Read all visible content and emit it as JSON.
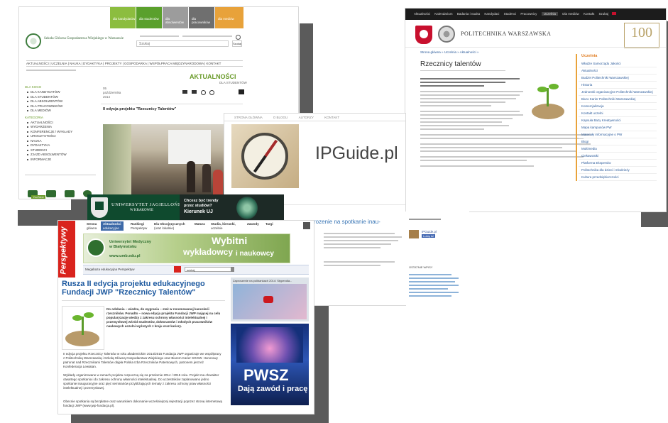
{
  "sggw": {
    "logo_text": "Szkoła Główna Gospodarstwa Wiejskiego w Warszawie",
    "tiles": [
      {
        "label": "dla kandydatów",
        "color": "#8cbd3f"
      },
      {
        "label": "dla studentów",
        "color": "#5aa02c"
      },
      {
        "label": "dla absolwentów",
        "color": "#9c9c9c"
      },
      {
        "label": "dla pracowników",
        "color": "#6f6f6f"
      },
      {
        "label": "dla mediów",
        "color": "#e8a23a"
      }
    ],
    "search_placeholder": "Szukaj",
    "search_button": "Szukaj",
    "nav": "AKTUALNOŚCI | UCZELNIA | NAUKA | DYDAKTYKA | PROJEKTY | GOSPODARKA | WSPÓŁPRACA MIĘDZYNARODOWA | KONTAKT",
    "heading": "AKTUALNOŚCI",
    "subheading": "DLA STUDENTÓW",
    "sidebar_title_1": "DLA KOGO",
    "sidebar_1": [
      "DLA KANDYDATÓW",
      "DLA STUDENTÓW",
      "DLA ABSOLWENTÓW",
      "DLA PRACOWNIKÓW",
      "DLA MEDIÓW"
    ],
    "sidebar_title_2": "KATEGORIA",
    "sidebar_2": [
      "AKTUALNOŚCI",
      "WYDARZENIA",
      "KONFERENCJE / WYKŁADY",
      "UROCZYSTOŚCI",
      "NAUKA",
      "DYDAKTYKA",
      "STUDENCI",
      "ZJAZD ABSOLWENTÓW",
      "INFORMACJE"
    ],
    "date_day": "05",
    "date_month": "października",
    "date_year": "2014",
    "article_title": "II edycja projektu \"Rzecznicy Talentów\"",
    "youtube": "YouTube"
  },
  "pw": {
    "topnav": [
      "Aktualności",
      "Kalendarium",
      "Badania i nauka",
      "Kandydaci",
      "Studenci",
      "Pracownicy",
      "Uczelnia",
      "Dla mediów",
      "Kontakt",
      "Szukaj"
    ],
    "name": "POLITECHNIKA WARSZAWSKA",
    "breadcrumb": "Strona główna » Uczelnia » Aktualności »",
    "title": "Rzecznicy talentów",
    "sidebar_title": "Uczelnia",
    "sidebar": [
      "Władze Samorządu Jakości",
      "Aktualności",
      "Budżet Politechniki Warszawskiej",
      "Historia",
      "Jednostki organizacyjne Politechniki Warszawskiej",
      "Biuro Karier Politechniki Warszawskiej",
      "Komercjalizacja",
      "Kontakt uczelni",
      "Kapsuła Bazy Kreatywności",
      "Mapa kampusów PW",
      "Materiały informacyjne o PW",
      "Blogi",
      "Multimedia",
      "Ciekawostki",
      "Platforma Ekspertów",
      "Politechnika dla dzieci i młodzieży",
      "Kultura przedsiębiorczości"
    ]
  },
  "ipguide": {
    "nav": [
      "STRONA GŁÓWNA",
      "O BLOGU",
      "AUTORZY",
      "KONTAKT"
    ],
    "logo": "IPGuide.pl",
    "headline_fragment": "rozenie na spotkanie inau-",
    "facebook_label": "IPGuide.pl",
    "like_label": "Lubię to!",
    "recent_title": "OSTATNIE WPISY"
  },
  "uj": {
    "name": "UNIWERSYTET JAGIELLOŃSKI",
    "city": "W KRAKOWIE",
    "promo_line1": "Chcesz być trendy",
    "promo_line2": "przez studiów?",
    "promo_line3": "Kierunek UJ"
  },
  "perspektywy": {
    "brand": "Perspektywy",
    "menu": [
      {
        "top": "Strona",
        "bottom": "główna"
      },
      {
        "top": "Aktualności",
        "bottom": "edukacyjne"
      },
      {
        "top": "Rankingi",
        "bottom": "Perspektyw"
      },
      {
        "top": "Dla Obcojęzycznych",
        "bottom": "(oraz lokalnie)"
      },
      {
        "top": "Matura",
        "bottom": ""
      },
      {
        "top": "Studia, kierunki,",
        "bottom": "uczelnie"
      },
      {
        "top": "Zawody",
        "bottom": ""
      },
      {
        "top": "Targi",
        "bottom": ""
      }
    ],
    "banner_university": "Uniwersytet Medyczny w Białymstoku",
    "banner_url": "www.umb.edu.pl",
    "banner_slogan_1": "Wybitni",
    "banner_slogan_2": "wykładowcy",
    "banner_slogan_3": "i naukowcy",
    "megabaza_label": "Megabaza edukacyjna Perspektyw",
    "select_value": "szukaj",
    "headline": "Rusza II edycja projektu edukacyjnego Fundacji JWP \"Rzecznicy Talentów\"",
    "video_caption": "Zaproszenie na polibankach 2014: Stypendia...",
    "pwsz_title": "PWSZ",
    "pwsz_sub": "Dają zawód i pracę",
    "intro": "Do odsłania – wiedza, do wygrania – staż w renomowanej kancelarii rzeczników. Ponadto – nowa edycja projektu Fundacji JWP mającej na celu popularyzację wiedzy z zakresu ochrony własności intelektualnej i przemysłowej wśród studentów, doktorantów i młodych pracowników naukowych uczelni wyższych z kraju oraz kariery.",
    "p1": "II edycja projektu Rzecznicy Talentów w roku akademickim 2014/2015 Fundacja JWP organizuje we współpracy z Politechniką Warszawską i Szkołą Główną Gospodarstwa Wiejskiego oraz Biurem Karier SGGW. Honorowy patronat nad Rzecznikami Talentów objęła Polska Izba Rzeczników Patentowych, patronem jest też Konfederacja Lewiatan.",
    "p2": "Wykłady organizowane w ramach projektu rozpoczną się na przełomie 2014 / 2015 roku. Projekt ma charakter otwartego spotkania i do zakresu ochrony własności intelektualnej. Do uczestników zaplanowano jedno spotkanie inauguracyjne oraz pięć seminariów przybliżających tematy z zakresu ochrony praw własności intelektualnej i przemysłowej.",
    "p3": "Obecnie spotkania są bezpłatne oraz warunkiem dokonanie wcześniejszej rejestracji poprzez stronę internetową fundacji JWP (www.jwp-fundacja.pl)."
  }
}
